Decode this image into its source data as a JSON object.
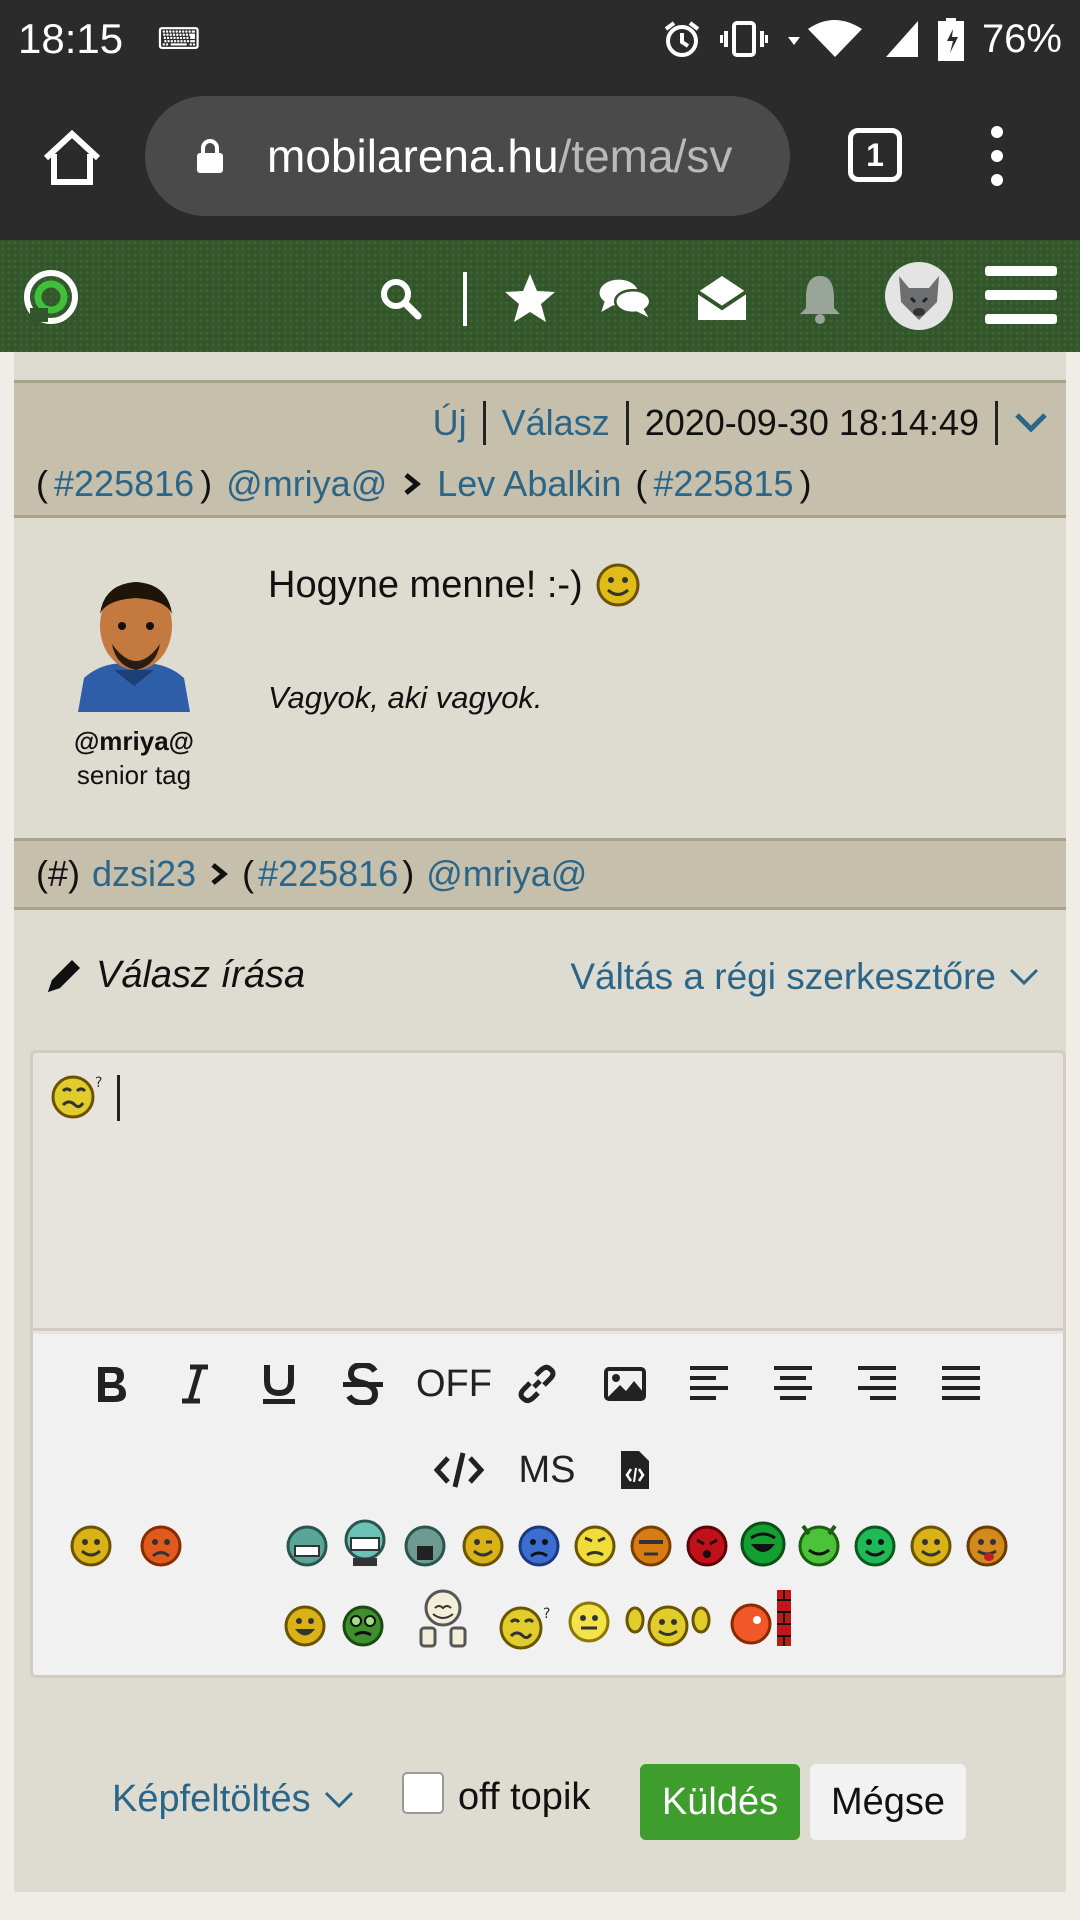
{
  "status_bar": {
    "time": "18:15",
    "battery": "76%"
  },
  "browser": {
    "url_domain": "mobilarena.hu",
    "url_path": "/tema/sv",
    "tab_count": "1"
  },
  "post": {
    "new_label": "Új",
    "reply_label": "Válasz",
    "timestamp": "2020-09-30 18:14:49",
    "open_paren": "(",
    "post_id": "#225816",
    "close_paren": ")",
    "author": "@mriya@",
    "reply_to_user": "Lev Abalkin",
    "reply_to_open": "(",
    "reply_to_id": "#225815",
    "reply_to_close": ")",
    "author_name": "@mriya@",
    "author_rank": "senior tag",
    "message": "Hogyne menne! :-)",
    "signature": "Vagyok, aki vagyok."
  },
  "reply_header": {
    "hash": "(#)",
    "user": "dzsi23",
    "target_open": "(",
    "target_id": "#225816",
    "target_close": ")",
    "target_user": "@mriya@"
  },
  "editor": {
    "title": "Válasz írása",
    "switch_label": "Váltás a régi szerkesztőre",
    "off_label": "OFF",
    "ms_label": "MS"
  },
  "footer": {
    "upload_label": "Képfeltöltés",
    "offtopic_label": "off topik",
    "send_label": "Küldés",
    "cancel_label": "Mégse"
  },
  "colors": {
    "link": "#2b6689",
    "send_button": "#3d9d2d",
    "nav_bg": "#33552b",
    "header_bg": "#c6bfab"
  }
}
